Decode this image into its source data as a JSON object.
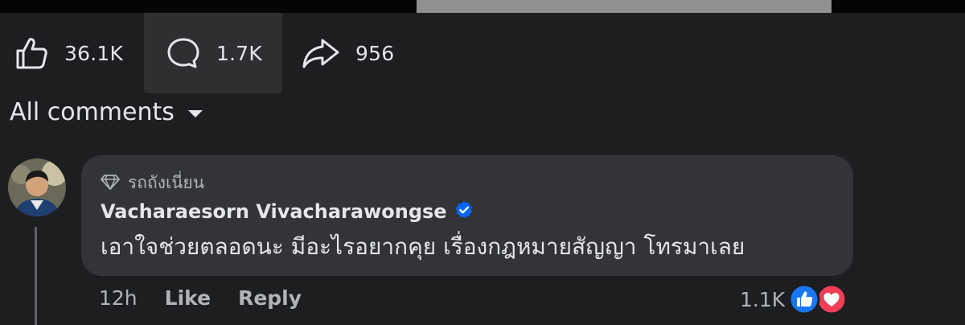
{
  "actions": {
    "like_count": "36.1K",
    "comment_count": "1.7K",
    "share_count": "956"
  },
  "comments_filter": {
    "label": "All comments"
  },
  "comment": {
    "badge_icon": "diamond-icon",
    "badge_label": "รถถังเนี่ยน",
    "author": "Vacharaesorn Vivacharawongse",
    "verified": true,
    "text": "เอาใจช่วยตลอดนะ มีอะไรอยากคุย เรื่องกฎหมายสัญญา โทรมาเลย",
    "time": "12h",
    "like_label": "Like",
    "reply_label": "Reply",
    "reaction_count": "1.1K",
    "reactions": [
      "like",
      "love"
    ]
  },
  "colors": {
    "background": "#1d1e20",
    "bubble": "#333437",
    "text_primary": "#e4e6eb",
    "text_secondary": "#b0b3b8",
    "verified_blue": "#0866ff",
    "like_blue": "#1877f2",
    "love_red": "#f33e58"
  }
}
